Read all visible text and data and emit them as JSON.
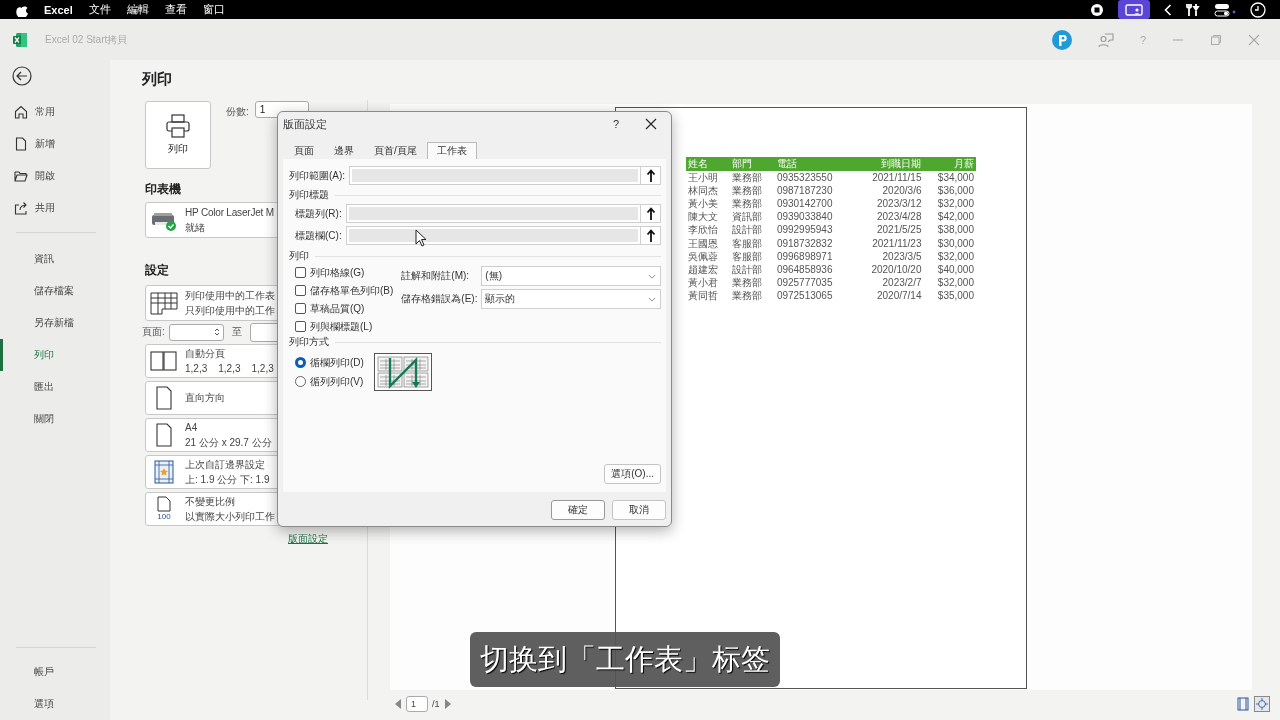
{
  "menubar": {
    "app": "Excel",
    "menus": [
      "文件",
      "編輯",
      "查看",
      "窗口"
    ]
  },
  "window": {
    "title": "Excel 02 Start拷貝",
    "help": "?"
  },
  "nav": {
    "top": [
      {
        "label": "常用",
        "selected": false
      },
      {
        "label": "新增",
        "selected": false
      },
      {
        "label": "開啟",
        "selected": false
      },
      {
        "label": "共用",
        "selected": false
      }
    ],
    "middle": [
      {
        "label": "資訊",
        "selected": false
      },
      {
        "label": "儲存檔案",
        "selected": false
      },
      {
        "label": "另存新檔",
        "selected": false
      },
      {
        "label": "列印",
        "selected": true
      },
      {
        "label": "匯出",
        "selected": false
      },
      {
        "label": "關閉",
        "selected": false
      }
    ],
    "bottom": [
      {
        "label": "帳戶",
        "selected": false
      },
      {
        "label": "選項",
        "selected": false
      }
    ]
  },
  "print_panel": {
    "title": "列印",
    "print_button": "列印",
    "copies_label": "份數:",
    "copies": "1",
    "printer_heading": "印表機",
    "printer": {
      "name": "HP Color LaserJet M",
      "status": "就緒"
    },
    "settings_heading": "設定",
    "settings": [
      {
        "kind": "sheet",
        "line1": "列印使用中的工作表",
        "line2": "只列印使用中的工作"
      },
      {
        "kind": "collate",
        "line1": "自動分頁",
        "line2_parts": [
          "1,2,3",
          "1,2,3",
          "1,2,3"
        ]
      },
      {
        "kind": "orientation",
        "line1": "直向方向"
      },
      {
        "kind": "paper",
        "line1": "A4",
        "line2": "21 公分 x 29.7 公分"
      },
      {
        "kind": "margins",
        "line1": "上次自訂邊界設定",
        "line2": "上: 1.9 公分 下: 1.9"
      },
      {
        "kind": "scaling",
        "line1": "不變更比例",
        "line2": "以實際大小列印工作",
        "icon_text": "100"
      }
    ],
    "pages_label": "頁面:",
    "to_label": "至",
    "page_setup_link": "版面設定"
  },
  "preview": {
    "table": {
      "columns": [
        "姓名",
        "部門",
        "電話",
        "到職日期",
        "月薪"
      ],
      "rows": [
        [
          "王小明",
          "業務部",
          "0935323550",
          "2021/11/15",
          "$34,000"
        ],
        [
          "林同杰",
          "業務部",
          "0987187230",
          "2020/3/6",
          "$36,000"
        ],
        [
          "黃小美",
          "業務部",
          "0930142700",
          "2023/3/12",
          "$32,000"
        ],
        [
          "陳大文",
          "資訊部",
          "0939033840",
          "2023/4/28",
          "$42,000"
        ],
        [
          "李欣怡",
          "設計部",
          "0992995943",
          "2021/5/25",
          "$38,000"
        ],
        [
          "王國恩",
          "客服部",
          "0918732832",
          "2021/11/23",
          "$30,000"
        ],
        [
          "吳佩蓉",
          "客服部",
          "0996898971",
          "2023/3/5",
          "$32,000"
        ],
        [
          "趙建宏",
          "設計部",
          "0964858936",
          "2020/10/20",
          "$40,000"
        ],
        [
          "黃小君",
          "業務部",
          "0925777035",
          "2023/2/7",
          "$32,000"
        ],
        [
          "黃同哲",
          "業務部",
          "0972513065",
          "2020/7/14",
          "$35,000"
        ]
      ]
    },
    "page_current": "1",
    "page_total": "/1"
  },
  "dialog": {
    "title": "版面設定",
    "help": "?",
    "tabs": [
      {
        "label": "頁面",
        "selected": false
      },
      {
        "label": "邊界",
        "selected": false
      },
      {
        "label": "頁首/頁尾",
        "selected": false
      },
      {
        "label": "工作表",
        "selected": true
      }
    ],
    "print_area_label": "列印範圍(A):",
    "titles_heading": "列印標題",
    "title_rows_label": "標題列(R):",
    "title_cols_label": "標題欄(C):",
    "print_heading": "列印",
    "checkboxes": [
      {
        "label": "列印格線(G)",
        "checked": false
      },
      {
        "label": "儲存格單色列印(B)",
        "checked": false
      },
      {
        "label": "草稿品質(Q)",
        "checked": false
      },
      {
        "label": "列與欄標題(L)",
        "checked": false
      }
    ],
    "comments_label": "註解和附註(M):",
    "comments_value": "(無)",
    "errors_label": "儲存格錯誤為(E):",
    "errors_value": "顯示的",
    "order_heading": "列印方式",
    "order_options": [
      {
        "label": "循欄列印(D)",
        "selected": true
      },
      {
        "label": "循列列印(V)",
        "selected": false
      }
    ],
    "options_button": "選項(O)...",
    "ok": "確定",
    "cancel": "取消"
  },
  "caption": "切换到「工作表」标签"
}
